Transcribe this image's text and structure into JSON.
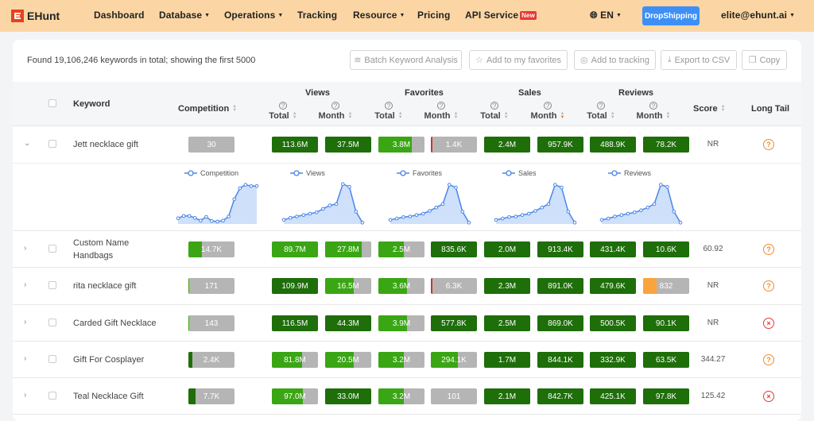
{
  "nav": {
    "logo": "EHunt",
    "items": [
      {
        "label": "Dashboard",
        "caret": false,
        "badge": ""
      },
      {
        "label": "Database",
        "caret": true,
        "badge": ""
      },
      {
        "label": "Operations",
        "caret": true,
        "badge": ""
      },
      {
        "label": "Tracking",
        "caret": false,
        "badge": ""
      },
      {
        "label": "Resource",
        "caret": true,
        "badge": ""
      },
      {
        "label": "Pricing",
        "caret": false,
        "badge": ""
      },
      {
        "label": "API Service",
        "caret": false,
        "badge": "New"
      }
    ],
    "lang": "EN",
    "dropshipping": "DropShipping",
    "user": "elite@ehunt.ai"
  },
  "summary": "Found 19,106,246 keywords in total; showing the first 5000",
  "toolbar": {
    "batch": "Batch Keyword Analysis",
    "favorites": "Add to my favorites",
    "tracking": "Add to tracking",
    "export": "Export to CSV",
    "copy": "Copy"
  },
  "headers": {
    "keyword": "Keyword",
    "competition": "Competition",
    "views": "Views",
    "favorites": "Favorites",
    "sales": "Sales",
    "reviews": "Reviews",
    "total": "Total",
    "month": "Month",
    "score": "Score",
    "long_tail": "Long Tail"
  },
  "colors": {
    "dark_green": "#1e6e0a",
    "light_green": "#3aa614",
    "gray": "#b5b5b5",
    "orange": "#f9a43c",
    "red": "#c0392b",
    "chart_line": "#4a86e8",
    "chart_fill": "#cfe0fa"
  },
  "trend_legends": [
    "Competition",
    "Views",
    "Favorites",
    "Sales",
    "Reviews"
  ],
  "trends": [
    [
      0.42,
      0.58,
      0.58,
      0.45,
      0.25,
      0.52,
      0.22,
      0.18,
      0.25,
      0.55,
      1.8,
      2.6,
      2.85,
      2.75,
      2.75
    ],
    [
      0.3,
      0.45,
      0.55,
      0.65,
      0.75,
      0.85,
      1.1,
      1.35,
      1.45,
      2.9,
      2.7,
      0.9,
      0.1
    ],
    [
      0.3,
      0.4,
      0.5,
      0.55,
      0.65,
      0.75,
      0.95,
      1.2,
      1.45,
      2.85,
      2.65,
      0.9,
      0.1
    ],
    [
      0.3,
      0.4,
      0.5,
      0.55,
      0.65,
      0.75,
      0.95,
      1.2,
      1.45,
      2.85,
      2.65,
      0.9,
      0.1
    ],
    [
      0.3,
      0.4,
      0.55,
      0.65,
      0.75,
      0.85,
      1.0,
      1.2,
      1.45,
      2.85,
      2.7,
      0.9,
      0.1
    ]
  ],
  "rows": [
    {
      "keyword": "Jett necklace gift",
      "expanded": true,
      "cells": [
        {
          "v": "30",
          "p": 0,
          "c": "gray"
        },
        {
          "v": "113.6M",
          "p": 1,
          "c": "dark"
        },
        {
          "v": "37.5M",
          "p": 1,
          "c": "dark"
        },
        {
          "v": "3.8M",
          "p": 0.72,
          "c": "light"
        },
        {
          "v": "1.4K",
          "p": 0.04,
          "c": "red"
        },
        {
          "v": "2.4M",
          "p": 1,
          "c": "dark"
        },
        {
          "v": "957.9K",
          "p": 1,
          "c": "dark"
        },
        {
          "v": "488.9K",
          "p": 1,
          "c": "dark"
        },
        {
          "v": "78.2K",
          "p": 1,
          "c": "dark"
        }
      ],
      "score": "NR",
      "long_tail": "q"
    },
    {
      "keyword": "Custom Name Handbags",
      "expanded": false,
      "cells": [
        {
          "v": "14.7K",
          "p": 0.3,
          "c": "light"
        },
        {
          "v": "89.7M",
          "p": 1,
          "c": "light"
        },
        {
          "v": "27.8M",
          "p": 0.8,
          "c": "light"
        },
        {
          "v": "2.5M",
          "p": 0.55,
          "c": "light"
        },
        {
          "v": "835.6K",
          "p": 1,
          "c": "dark"
        },
        {
          "v": "2.0M",
          "p": 1,
          "c": "dark"
        },
        {
          "v": "913.4K",
          "p": 1,
          "c": "dark"
        },
        {
          "v": "431.4K",
          "p": 1,
          "c": "dark"
        },
        {
          "v": "10.6K",
          "p": 1,
          "c": "dark"
        }
      ],
      "score": "60.92",
      "long_tail": "q"
    },
    {
      "keyword": "rita necklace gift",
      "expanded": false,
      "cells": [
        {
          "v": "171",
          "p": 0.02,
          "c": "light"
        },
        {
          "v": "109.9M",
          "p": 1,
          "c": "dark"
        },
        {
          "v": "16.5M",
          "p": 0.62,
          "c": "light"
        },
        {
          "v": "3.6M",
          "p": 0.62,
          "c": "light"
        },
        {
          "v": "6.3K",
          "p": 0.04,
          "c": "red"
        },
        {
          "v": "2.3M",
          "p": 1,
          "c": "dark"
        },
        {
          "v": "891.0K",
          "p": 1,
          "c": "dark"
        },
        {
          "v": "479.6K",
          "p": 1,
          "c": "dark"
        },
        {
          "v": "832",
          "p": 0.3,
          "c": "orange"
        }
      ],
      "score": "NR",
      "long_tail": "q"
    },
    {
      "keyword": "Carded Gift Necklace",
      "expanded": false,
      "cells": [
        {
          "v": "143",
          "p": 0.02,
          "c": "light"
        },
        {
          "v": "116.5M",
          "p": 1,
          "c": "dark"
        },
        {
          "v": "44.3M",
          "p": 1,
          "c": "dark"
        },
        {
          "v": "3.9M",
          "p": 0.62,
          "c": "light"
        },
        {
          "v": "577.8K",
          "p": 1,
          "c": "dark"
        },
        {
          "v": "2.5M",
          "p": 1,
          "c": "dark"
        },
        {
          "v": "869.0K",
          "p": 1,
          "c": "dark"
        },
        {
          "v": "500.5K",
          "p": 1,
          "c": "dark"
        },
        {
          "v": "90.1K",
          "p": 1,
          "c": "dark"
        }
      ],
      "score": "NR",
      "long_tail": "x"
    },
    {
      "keyword": "Gift For Cosplayer",
      "expanded": false,
      "cells": [
        {
          "v": "2.4K",
          "p": 0.08,
          "c": "dark"
        },
        {
          "v": "81.8M",
          "p": 0.65,
          "c": "light"
        },
        {
          "v": "20.5M",
          "p": 0.62,
          "c": "light"
        },
        {
          "v": "3.2M",
          "p": 0.55,
          "c": "light"
        },
        {
          "v": "294.1K",
          "p": 0.58,
          "c": "light"
        },
        {
          "v": "1.7M",
          "p": 1,
          "c": "dark"
        },
        {
          "v": "844.1K",
          "p": 1,
          "c": "dark"
        },
        {
          "v": "332.9K",
          "p": 1,
          "c": "dark"
        },
        {
          "v": "63.5K",
          "p": 1,
          "c": "dark"
        }
      ],
      "score": "344.27",
      "long_tail": "q"
    },
    {
      "keyword": "Teal Necklace Gift",
      "expanded": false,
      "cells": [
        {
          "v": "7.7K",
          "p": 0.15,
          "c": "dark"
        },
        {
          "v": "97.0M",
          "p": 0.68,
          "c": "light"
        },
        {
          "v": "33.0M",
          "p": 1,
          "c": "dark"
        },
        {
          "v": "3.2M",
          "p": 0.55,
          "c": "light"
        },
        {
          "v": "101",
          "p": 0,
          "c": "gray"
        },
        {
          "v": "2.1M",
          "p": 1,
          "c": "dark"
        },
        {
          "v": "842.7K",
          "p": 1,
          "c": "dark"
        },
        {
          "v": "425.1K",
          "p": 1,
          "c": "dark"
        },
        {
          "v": "97.8K",
          "p": 1,
          "c": "dark"
        }
      ],
      "score": "125.42",
      "long_tail": "x"
    }
  ]
}
